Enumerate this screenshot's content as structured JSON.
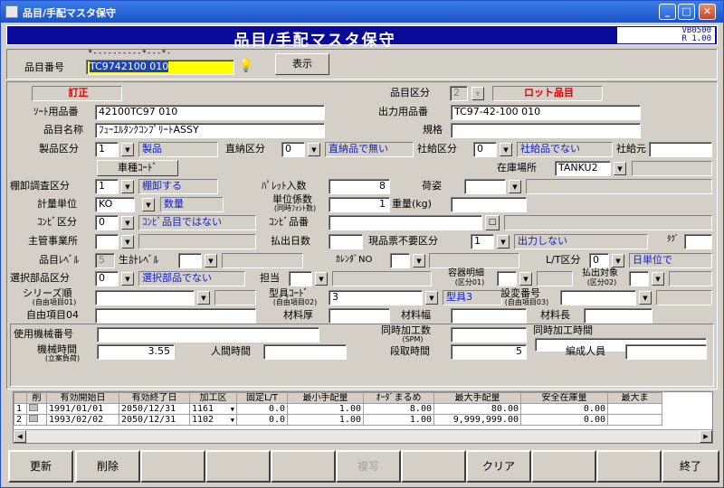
{
  "window": {
    "title": "品目/手配マスタ保守"
  },
  "header": {
    "title": "品目/手配マスタ保守",
    "version_code": "VB0500",
    "version_rev": "R 1.00"
  },
  "top": {
    "item_no_label": "品目番号",
    "item_no_mask": "*----------*---*-",
    "item_no_value": "TC9742100    010",
    "display_button": "表示"
  },
  "form": {
    "mode": "訂正",
    "item_class_label": "品目区分",
    "item_class_value": "2",
    "item_class_name": "ロット品目",
    "sort_item_no_label": "ｿｰﾄ用品番",
    "sort_item_no_value": "42100TC97    010",
    "output_item_no_label": "出力用品番",
    "output_item_no_value": "TC97-42-100        010",
    "item_name_label": "品目名称",
    "item_name_value": "ﾌｭｰｴﾙﾀﾝｸｺﾝﾌﾟﾘｰﾄASSY",
    "spec_label": "規格",
    "product_class_label": "製品区分",
    "product_class_value": "1",
    "product_class_name": "製品",
    "direct_class_label": "直納区分",
    "direct_class_value": "0",
    "direct_class_name": "直納品で無い",
    "company_class_label": "社給区分",
    "company_class_value": "0",
    "company_class_name": "社給品でない",
    "company_source_label": "社給元",
    "car_code_button": "車種ｺｰﾄﾞ",
    "stock_location_label": "在庫場所",
    "stock_location_value": "TANKU2",
    "inventory_class_label": "棚卸調査区分",
    "inventory_class_value": "1",
    "inventory_class_name": "棚卸する",
    "pallet_qty_label": "ﾊﾟﾚｯﾄ入数",
    "pallet_qty_value": "8",
    "packing_label": "荷姿",
    "unit_label": "計量単位",
    "unit_value": "KO",
    "unit_name": "数量",
    "unit_factor_label": "単位係数",
    "unit_factor_sub": "(同時ﾌｫｼﾄ数)",
    "unit_factor_value": "1",
    "weight_label": "重量(kg)",
    "combi_class_label": "ｺﾝﾋﾞ区分",
    "combi_class_value": "0",
    "combi_class_name": "ｺﾝﾋﾞ品目ではない",
    "combi_item_label": "ｺﾝﾋﾞ品番",
    "combi_button": "□",
    "main_office_label": "主管事業所",
    "shipment_days_label": "払出日数",
    "ticket_unneeded_label": "現品票不要区分",
    "ticket_unneeded_value": "1",
    "ticket_unneeded_name": "出力しない",
    "tag_label": "ﾀｸﾞ",
    "item_level_label": "品目ﾚﾍﾞﾙ",
    "item_level_value": "5",
    "gen_level_label": "生計ﾚﾍﾞﾙ",
    "calendar_label": "ｶﾚﾝﾀﾞNO",
    "lt_class_label": "L/T区分",
    "lt_class_value": "0",
    "lt_class_name": "日単位で",
    "select_class_label": "選択部品区分",
    "select_class_value": "0",
    "select_class_name": "選択部品でない",
    "person_label": "担当",
    "container_label": "容器明細",
    "container_sub": "(区分01)",
    "payout_label": "払出対象",
    "payout_sub": "(区分02)",
    "series_label": "シリーズ順",
    "series_sub": "(自由項目01)",
    "die_code_label": "型具ｺｰﾄﾞ",
    "die_code_sub": "(自由項目02)",
    "die_code_value": "3",
    "die_code_name": "型具3",
    "design_change_label": "設変番号",
    "design_change_sub": "(自由項目03)",
    "free04_label": "自由項目04",
    "material_thick_label": "材料厚",
    "material_width_label": "材料幅",
    "material_length_label": "材料長",
    "machine_no_label": "使用機械番号",
    "simul_count_label": "同時加工数",
    "simul_count_sub": "(SPM)",
    "simul_time_label": "同時加工時間",
    "machine_time_label": "機械時間",
    "machine_time_sub": "(立案負荷)",
    "machine_time_value": "3.55",
    "human_time_label": "人間時間",
    "setup_time_label": "段取時間",
    "setup_time_value": "5",
    "staff_label": "編成人員"
  },
  "grid": {
    "headers": [
      "",
      "削",
      "有効開始日",
      "有効終了日",
      "加工区",
      "固定L/T",
      "最小手配量",
      "ｵｰﾀﾞまるめ",
      "最大手配量",
      "安全在庫量",
      "最大ま"
    ],
    "rows": [
      [
        "1",
        "",
        "1991/01/01",
        "2050/12/31",
        "1161",
        "0.0",
        "1.00",
        "8.00",
        "80.00",
        "0.00",
        ""
      ],
      [
        "2",
        "",
        "1993/02/02",
        "2050/12/31",
        "1102",
        "0.0",
        "1.00",
        "1.00",
        "9,999,999.00",
        "0.00",
        ""
      ]
    ]
  },
  "footer": {
    "buttons": [
      "更新",
      "削除",
      "",
      "",
      "",
      "複写",
      "",
      "クリア",
      "",
      "",
      "終了"
    ]
  }
}
